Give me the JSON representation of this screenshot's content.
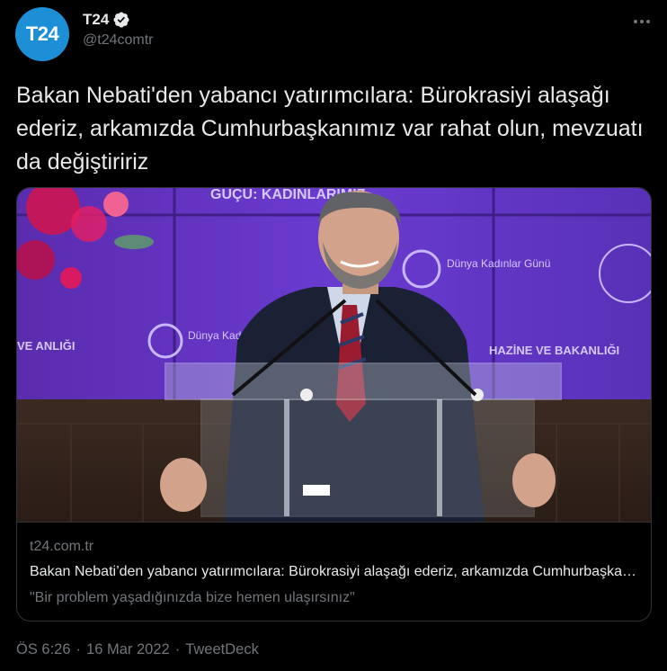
{
  "author": {
    "avatar_text": "T24",
    "name": "T24",
    "handle": "@t24comtr",
    "verified": true
  },
  "tweet": {
    "text": "Bakan Nebati'den yabancı yatırımcılara: Bürokrasiyi alaşağı ederiz, arkamızda Cumhurbaşkanımız var rahat olun, mevzuatı da değiştiririz"
  },
  "card": {
    "image_texts": {
      "top_banner": "GÜÇÜ: KADINLARIMIZ",
      "logo_right": "Dünya Kadınlar Günü",
      "logo_left": "Dünya Kadın",
      "left_edge": "VE ANLIĞI",
      "right_mid": "HAZİNE VE BAKANLIĞI"
    },
    "domain": "t24.com.tr",
    "title": "Bakan Nebati’den yabancı yatırımcılara: Bürokrasiyi alaşağı ederiz, arkamızda Cumhurbaşkanımız var rahat olun, mevzuatı da değiştiririz",
    "description": "\"Bir problem yaşadığınızda bize hemen ulaşırsınız\""
  },
  "footer": {
    "time": "ÖS 6:26",
    "separator": "·",
    "date": "16 Mar 2022",
    "source": "TweetDeck"
  },
  "icons": {
    "verified": "verified-badge-icon",
    "more": "more-dots-icon"
  },
  "colors": {
    "avatar_bg": "#1d8fd6",
    "text_primary": "#e7e9ea",
    "text_secondary": "#71767b",
    "border": "#2f3336"
  }
}
